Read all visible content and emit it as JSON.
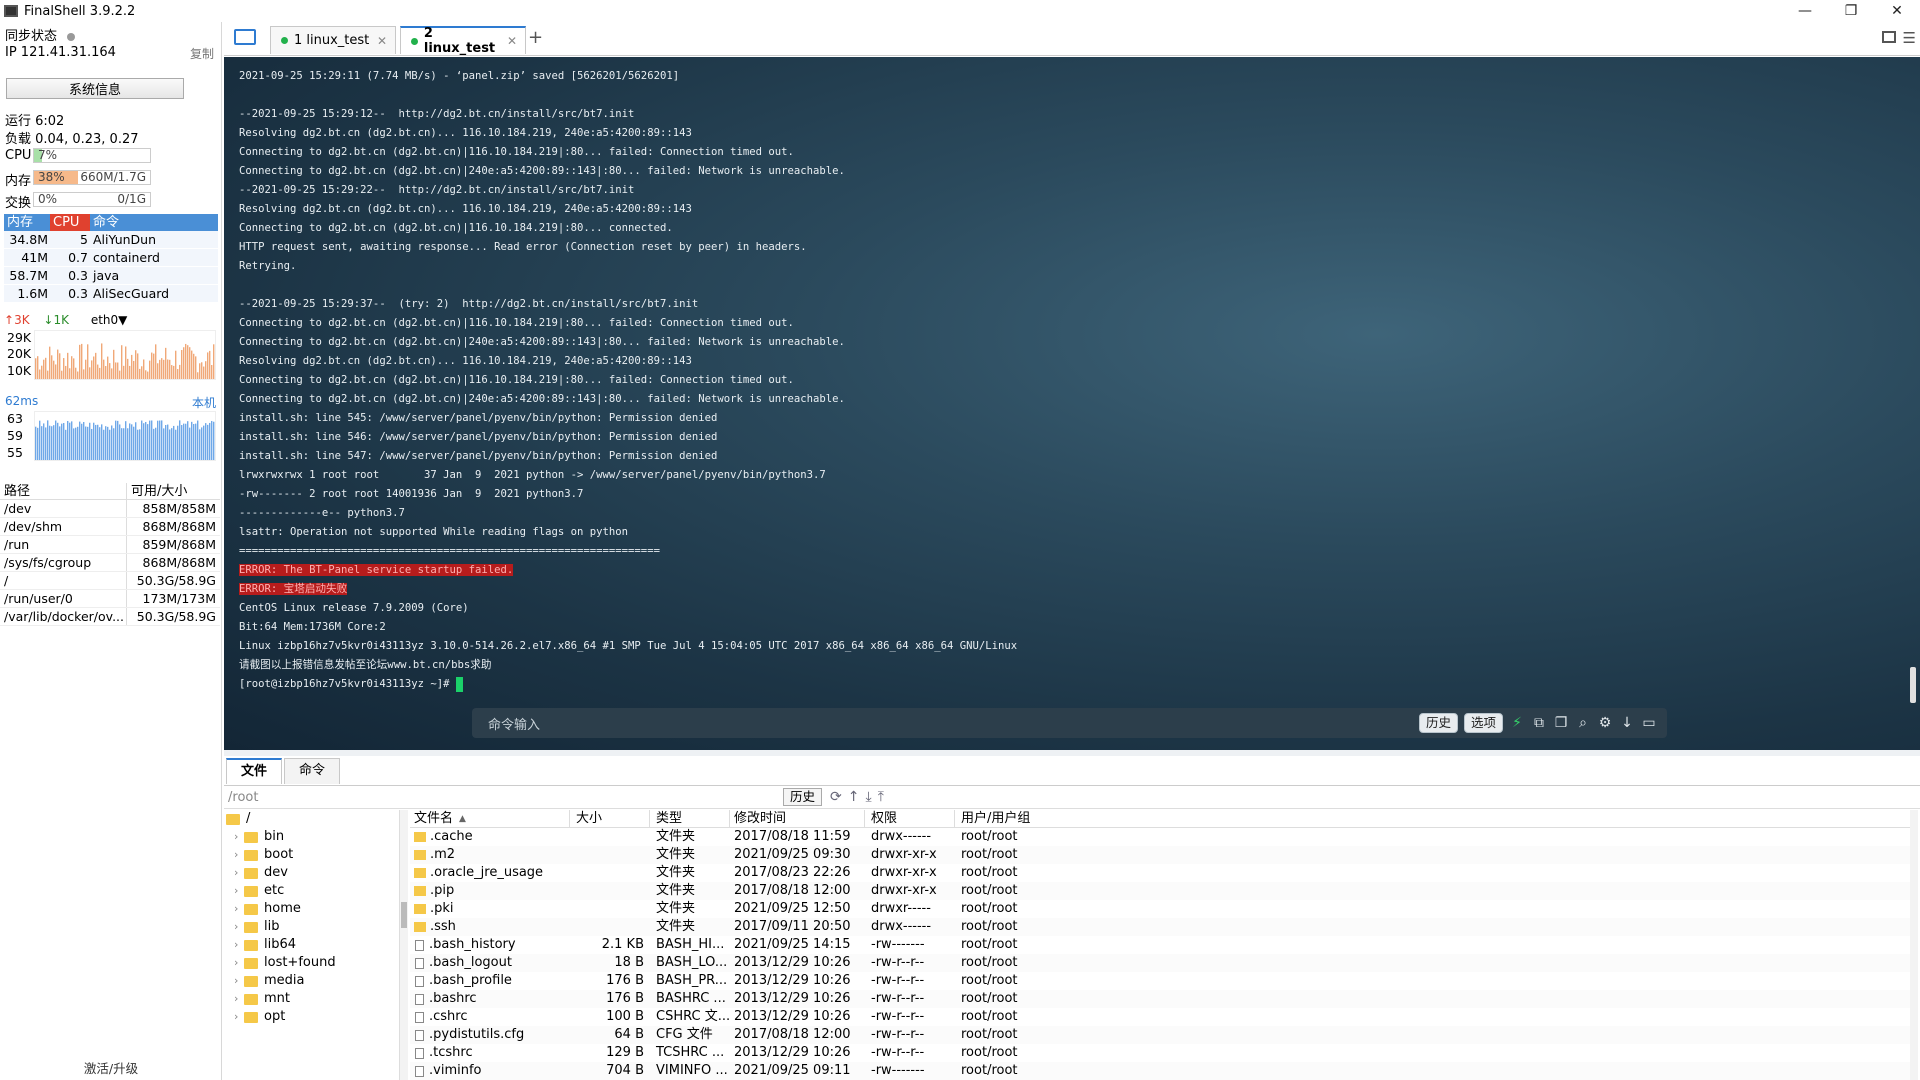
{
  "app": {
    "title": "FinalShell 3.9.2.2"
  },
  "sidebar": {
    "sync_label": "同步状态",
    "ip": "IP 121.41.31.164",
    "copy_label": "复制",
    "sysinfo_button": "系统信息",
    "uptime": "运行 6:02",
    "load": "负载 0.04, 0.23, 0.27",
    "cpu": {
      "label": "CPU",
      "pct_text": "7%",
      "value": 0.07
    },
    "mem": {
      "label": "内存",
      "pct_text": "38%",
      "amount": "660M/1.7G",
      "value": 0.38
    },
    "swap": {
      "label": "交换",
      "pct_text": "0%",
      "amount": "0/1G",
      "value": 0.0
    },
    "proc_headers": [
      "内存",
      "CPU",
      "命令"
    ],
    "processes": [
      {
        "mem": "34.8M",
        "cpu": "5",
        "cmd": "AliYunDun"
      },
      {
        "mem": "41M",
        "cpu": "0.7",
        "cmd": "containerd"
      },
      {
        "mem": "58.7M",
        "cpu": "0.3",
        "cmd": "java"
      },
      {
        "mem": "1.6M",
        "cpu": "0.3",
        "cmd": "AliSecGuard"
      }
    ],
    "net": {
      "up": "3K",
      "down": "1K",
      "iface": "eth0",
      "ylabels": [
        "29K",
        "20K",
        "10K"
      ]
    },
    "ping": {
      "value": "62ms",
      "target": "本机",
      "ylabels": [
        "63",
        "59",
        "55"
      ]
    },
    "disk_headers": [
      "路径",
      "可用/大小"
    ],
    "disks": [
      {
        "path": "/dev",
        "size": "858M/858M"
      },
      {
        "path": "/dev/shm",
        "size": "868M/868M"
      },
      {
        "path": "/run",
        "size": "859M/868M"
      },
      {
        "path": "/sys/fs/cgroup",
        "size": "868M/868M"
      },
      {
        "path": "/",
        "size": "50.3G/58.9G"
      },
      {
        "path": "/run/user/0",
        "size": "173M/173M"
      },
      {
        "path": "/var/lib/docker/ov...",
        "size": "50.3G/58.9G"
      }
    ],
    "activate": "激活/升级"
  },
  "tabs": [
    {
      "label": "1 linux_test",
      "active": false
    },
    {
      "label": "2 linux_test",
      "active": true
    }
  ],
  "terminal": {
    "lines": [
      "2021-09-25 15:29:11 (7.74 MB/s) - ‘panel.zip’ saved [5626201/5626201]",
      "",
      "--2021-09-25 15:29:12--  http://dg2.bt.cn/install/src/bt7.init",
      "Resolving dg2.bt.cn (dg2.bt.cn)... 116.10.184.219, 240e:a5:4200:89::143",
      "Connecting to dg2.bt.cn (dg2.bt.cn)|116.10.184.219|:80... failed: Connection timed out.",
      "Connecting to dg2.bt.cn (dg2.bt.cn)|240e:a5:4200:89::143|:80... failed: Network is unreachable.",
      "--2021-09-25 15:29:22--  http://dg2.bt.cn/install/src/bt7.init",
      "Resolving dg2.bt.cn (dg2.bt.cn)... 116.10.184.219, 240e:a5:4200:89::143",
      "Connecting to dg2.bt.cn (dg2.bt.cn)|116.10.184.219|:80... connected.",
      "HTTP request sent, awaiting response... Read error (Connection reset by peer) in headers.",
      "Retrying.",
      "",
      "--2021-09-25 15:29:37--  (try: 2)  http://dg2.bt.cn/install/src/bt7.init",
      "Connecting to dg2.bt.cn (dg2.bt.cn)|116.10.184.219|:80... failed: Connection timed out.",
      "Connecting to dg2.bt.cn (dg2.bt.cn)|240e:a5:4200:89::143|:80... failed: Network is unreachable.",
      "Resolving dg2.bt.cn (dg2.bt.cn)... 116.10.184.219, 240e:a5:4200:89::143",
      "Connecting to dg2.bt.cn (dg2.bt.cn)|116.10.184.219|:80... failed: Connection timed out.",
      "Connecting to dg2.bt.cn (dg2.bt.cn)|240e:a5:4200:89::143|:80... failed: Network is unreachable.",
      "install.sh: line 545: /www/server/panel/pyenv/bin/python: Permission denied",
      "install.sh: line 546: /www/server/panel/pyenv/bin/python: Permission denied",
      "install.sh: line 547: /www/server/panel/pyenv/bin/python: Permission denied",
      "lrwxrwxrwx 1 root root       37 Jan  9  2021 python -> /www/server/panel/pyenv/bin/python3.7",
      "-rw------- 2 root root 14001936 Jan  9  2021 python3.7",
      "-------------e-- python3.7",
      "lsattr: Operation not supported While reading flags on python",
      "==================================================================",
      "ERROR: The BT-Panel service startup failed.",
      "ERROR: 宝塔启动失败",
      "CentOS Linux release 7.9.2009 (Core)",
      "Bit:64 Mem:1736M Core:2",
      "Linux izbp16hz7v5kvr0i43113yz 3.10.0-514.26.2.el7.x86_64 #1 SMP Tue Jul 4 15:04:05 UTC 2017 x86_64 x86_64 x86_64 GNU/Linux",
      "请截图以上报错信息发帖至论坛www.bt.cn/bbs求助",
      "[root@izbp16hz7v5kvr0i43113yz ~]# "
    ],
    "error_line_indices": [
      26,
      27
    ],
    "cmd_placeholder": "命令输入",
    "history_btn": "历史",
    "options_btn": "选项"
  },
  "bottom": {
    "tabs": [
      "文件",
      "命令"
    ],
    "path": "/root",
    "history_btn": "历史",
    "tree": [
      "/",
      "bin",
      "boot",
      "dev",
      "etc",
      "home",
      "lib",
      "lib64",
      "lost+found",
      "media",
      "mnt",
      "opt"
    ],
    "file_headers": [
      "文件名",
      "大小",
      "类型",
      "修改时间",
      "权限",
      "用户/用户组"
    ],
    "files": [
      {
        "name": ".cache",
        "size": "",
        "type": "文件夹",
        "mod": "2017/08/18 11:59",
        "perm": "drwx------",
        "owner": "root/root",
        "dir": true
      },
      {
        "name": ".m2",
        "size": "",
        "type": "文件夹",
        "mod": "2021/09/25 09:30",
        "perm": "drwxr-xr-x",
        "owner": "root/root",
        "dir": true
      },
      {
        "name": ".oracle_jre_usage",
        "size": "",
        "type": "文件夹",
        "mod": "2017/08/23 22:26",
        "perm": "drwxr-xr-x",
        "owner": "root/root",
        "dir": true
      },
      {
        "name": ".pip",
        "size": "",
        "type": "文件夹",
        "mod": "2017/08/18 12:00",
        "perm": "drwxr-xr-x",
        "owner": "root/root",
        "dir": true
      },
      {
        "name": ".pki",
        "size": "",
        "type": "文件夹",
        "mod": "2021/09/25 12:50",
        "perm": "drwxr-----",
        "owner": "root/root",
        "dir": true
      },
      {
        "name": ".ssh",
        "size": "",
        "type": "文件夹",
        "mod": "2017/09/11 20:50",
        "perm": "drwx------",
        "owner": "root/root",
        "dir": true
      },
      {
        "name": ".bash_history",
        "size": "2.1 KB",
        "type": "BASH_HI...",
        "mod": "2021/09/25 14:15",
        "perm": "-rw-------",
        "owner": "root/root",
        "dir": false
      },
      {
        "name": ".bash_logout",
        "size": "18 B",
        "type": "BASH_LO...",
        "mod": "2013/12/29 10:26",
        "perm": "-rw-r--r--",
        "owner": "root/root",
        "dir": false
      },
      {
        "name": ".bash_profile",
        "size": "176 B",
        "type": "BASH_PR...",
        "mod": "2013/12/29 10:26",
        "perm": "-rw-r--r--",
        "owner": "root/root",
        "dir": false
      },
      {
        "name": ".bashrc",
        "size": "176 B",
        "type": "BASHRC ...",
        "mod": "2013/12/29 10:26",
        "perm": "-rw-r--r--",
        "owner": "root/root",
        "dir": false
      },
      {
        "name": ".cshrc",
        "size": "100 B",
        "type": "CSHRC 文...",
        "mod": "2013/12/29 10:26",
        "perm": "-rw-r--r--",
        "owner": "root/root",
        "dir": false
      },
      {
        "name": ".pydistutils.cfg",
        "size": "64 B",
        "type": "CFG 文件",
        "mod": "2017/08/18 12:00",
        "perm": "-rw-r--r--",
        "owner": "root/root",
        "dir": false
      },
      {
        "name": ".tcshrc",
        "size": "129 B",
        "type": "TCSHRC ...",
        "mod": "2013/12/29 10:26",
        "perm": "-rw-r--r--",
        "owner": "root/root",
        "dir": false
      },
      {
        "name": ".viminfo",
        "size": "704 B",
        "type": "VIMINFO ...",
        "mod": "2021/09/25 09:11",
        "perm": "-rw-------",
        "owner": "root/root",
        "dir": false
      }
    ]
  },
  "colors": {
    "accent": "#2e7bd1",
    "proc_header": "#4a8fd6",
    "cpu_fill": "#a8e0a8",
    "mem_fill": "#f6b98a",
    "chart_fill": "#f0a878",
    "ping_fill": "#6fa8e8",
    "error_bg": "#b71c1c",
    "cursor": "#1bd16a"
  }
}
